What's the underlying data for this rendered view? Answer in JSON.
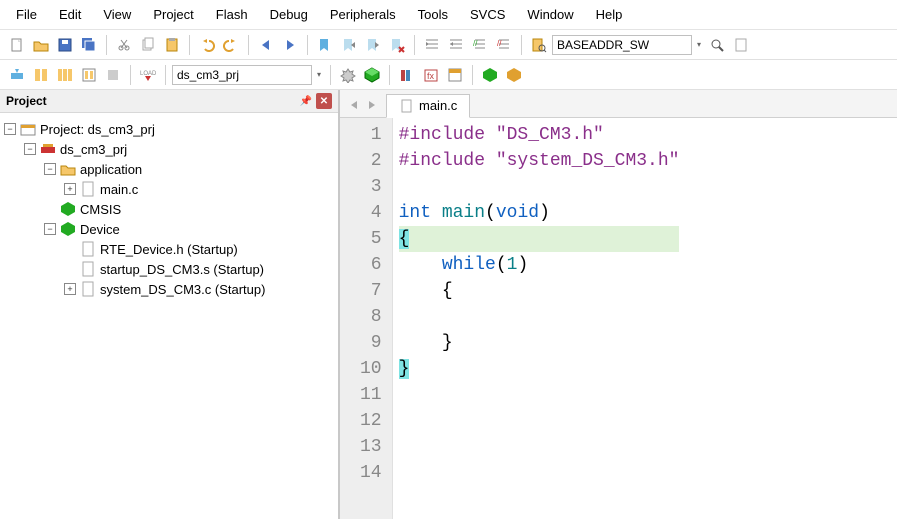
{
  "menus": [
    "File",
    "Edit",
    "View",
    "Project",
    "Flash",
    "Debug",
    "Peripherals",
    "Tools",
    "SVCS",
    "Window",
    "Help"
  ],
  "toolbar_dropdown": "BASEADDR_SW",
  "target_box": "ds_cm3_prj",
  "panel": {
    "title": "Project"
  },
  "tree": {
    "root": "Project: ds_cm3_prj",
    "target": "ds_cm3_prj",
    "groups": {
      "application": {
        "label": "application",
        "files": [
          "main.c"
        ]
      },
      "cmsis": {
        "label": "CMSIS"
      },
      "device": {
        "label": "Device",
        "files": [
          "RTE_Device.h (Startup)",
          "startup_DS_CM3.s (Startup)",
          "system_DS_CM3.c (Startup)"
        ]
      }
    }
  },
  "tab": {
    "label": "main.c"
  },
  "code": {
    "lines": [
      {
        "n": 1,
        "tokens": [
          [
            "pp",
            "#include "
          ],
          [
            "str",
            "\"DS_CM3.h\""
          ]
        ]
      },
      {
        "n": 2,
        "tokens": [
          [
            "pp",
            "#include "
          ],
          [
            "str",
            "\"system_DS_CM3.h\""
          ]
        ]
      },
      {
        "n": 3,
        "tokens": []
      },
      {
        "n": 4,
        "tokens": [
          [
            "blue",
            "int"
          ],
          [
            "txt",
            " "
          ],
          [
            "teal",
            "main"
          ],
          [
            "txt",
            "("
          ],
          [
            "blue",
            "void"
          ],
          [
            "txt",
            ")"
          ]
        ]
      },
      {
        "n": 5,
        "hl": true,
        "tokens": [
          [
            "bracehl",
            "{"
          ]
        ]
      },
      {
        "n": 6,
        "tokens": [
          [
            "txt",
            "    "
          ],
          [
            "blue",
            "while"
          ],
          [
            "txt",
            "("
          ],
          [
            "teal",
            "1"
          ],
          [
            "txt",
            ")"
          ]
        ]
      },
      {
        "n": 7,
        "tokens": [
          [
            "txt",
            "    {"
          ]
        ]
      },
      {
        "n": 8,
        "tokens": []
      },
      {
        "n": 9,
        "tokens": [
          [
            "txt",
            "    }"
          ]
        ]
      },
      {
        "n": 10,
        "tokens": [
          [
            "bracehl",
            "}"
          ]
        ]
      },
      {
        "n": 11,
        "tokens": []
      },
      {
        "n": 12,
        "tokens": []
      },
      {
        "n": 13,
        "tokens": []
      },
      {
        "n": 14,
        "tokens": []
      }
    ]
  }
}
